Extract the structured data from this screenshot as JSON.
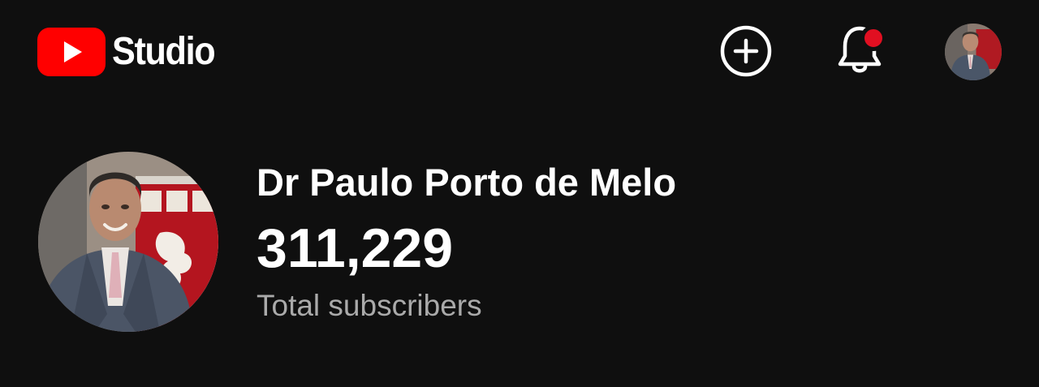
{
  "header": {
    "logo_text": "Studio",
    "brand_color": "#ff0000",
    "icons": {
      "logo": "youtube-play-logo",
      "create": "add-circle-icon",
      "notifications": "bell-icon",
      "account": "account-avatar"
    },
    "notification_dot_color": "#e10f21"
  },
  "channel": {
    "name": "Dr Paulo Porto de Melo",
    "subscriber_count": "311,229",
    "subscriber_label": "Total subscribers"
  },
  "colors": {
    "background": "#0f0f0f",
    "text_primary": "#ffffff",
    "text_secondary": "#aaaaaa"
  }
}
